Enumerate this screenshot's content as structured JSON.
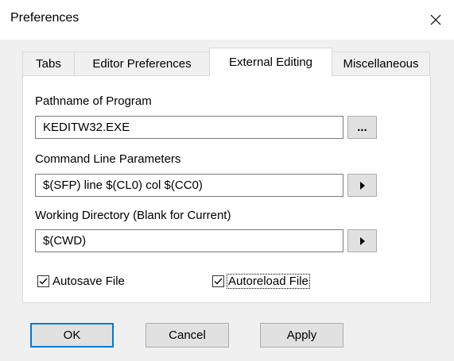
{
  "window": {
    "title": "Preferences",
    "close_icon": "close-icon"
  },
  "tabs": [
    {
      "label": "Tabs",
      "active": false
    },
    {
      "label": "Editor Preferences",
      "active": false
    },
    {
      "label": "External Editing",
      "active": true
    },
    {
      "label": "Miscellaneous",
      "active": false
    }
  ],
  "fields": {
    "program": {
      "label": "Pathname of Program",
      "value": "KEDITW32.EXE",
      "button_label": "...",
      "button_icon": "ellipsis-icon"
    },
    "params": {
      "label": "Command Line Parameters",
      "value": "$(SFP) line $(CL0) col $(CC0)",
      "button_icon": "triangle-right-icon"
    },
    "workdir": {
      "label": "Working Directory (Blank for Current)",
      "value": "$(CWD)",
      "button_icon": "triangle-right-icon"
    }
  },
  "checkboxes": {
    "autosave": {
      "label": "Autosave File",
      "checked": true
    },
    "autoreload": {
      "label": "Autoreload File",
      "checked": true
    }
  },
  "buttons": {
    "ok": "OK",
    "cancel": "Cancel",
    "apply": "Apply"
  },
  "colors": {
    "dialog_bg": "#f0f0f0",
    "default_button_border": "#0078d7"
  }
}
